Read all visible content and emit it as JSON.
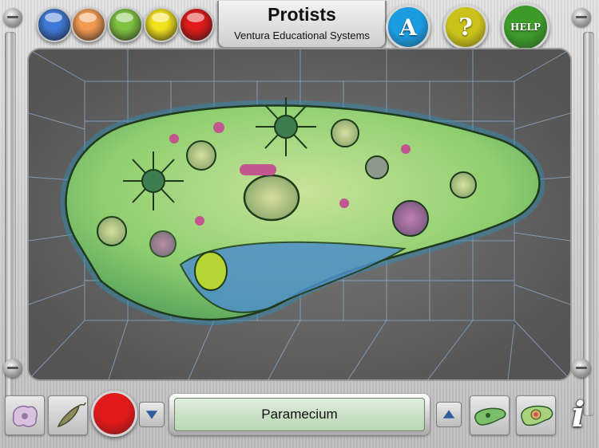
{
  "app": {
    "title": "Protists",
    "subtitle": "Ventura Educational Systems"
  },
  "header": {
    "color_buttons": [
      {
        "name": "blue",
        "color": "#3f78d6"
      },
      {
        "name": "orange",
        "color": "#f29a52"
      },
      {
        "name": "green",
        "color": "#7fc241"
      },
      {
        "name": "yellow",
        "color": "#f2e21c"
      },
      {
        "name": "red",
        "color": "#e01a1a"
      }
    ],
    "answer_button": {
      "label": "A",
      "color": "#1b9be0"
    },
    "question_button": {
      "label": "?",
      "color": "#c9c21a"
    },
    "help_button": {
      "label": "HELP",
      "color": "#3d9b2a"
    }
  },
  "viewer": {
    "organism_icon": "paramecium-illustration",
    "background_color": "#6d6d6d",
    "grid_color": "#8fb3d9"
  },
  "bottom": {
    "thumb_left_1_icon": "amoeba-thumbnail-icon",
    "thumb_left_2_icon": "euglena-thumbnail-icon",
    "record_button_color": "#e01a1a",
    "down_arrow_icon": "down-arrow-icon",
    "up_arrow_icon": "up-arrow-icon",
    "organism_label": "Paramecium",
    "thumb_right_1_icon": "paramecium-thumbnail-icon",
    "thumb_right_2_icon": "paramecium-detail-thumbnail-icon",
    "info_label": "i"
  }
}
